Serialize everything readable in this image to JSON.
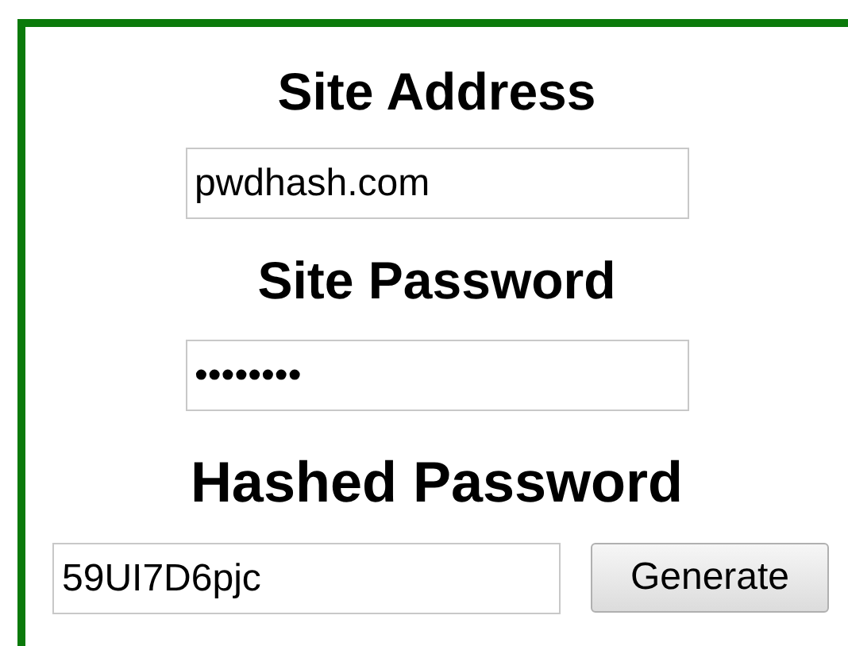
{
  "site_address": {
    "label": "Site Address",
    "value": "pwdhash.com"
  },
  "site_password": {
    "label": "Site Password",
    "value": "••••••••"
  },
  "hashed_password": {
    "label": "Hashed Password",
    "value": "59UI7D6pjc"
  },
  "buttons": [
    "Generate"
  ]
}
